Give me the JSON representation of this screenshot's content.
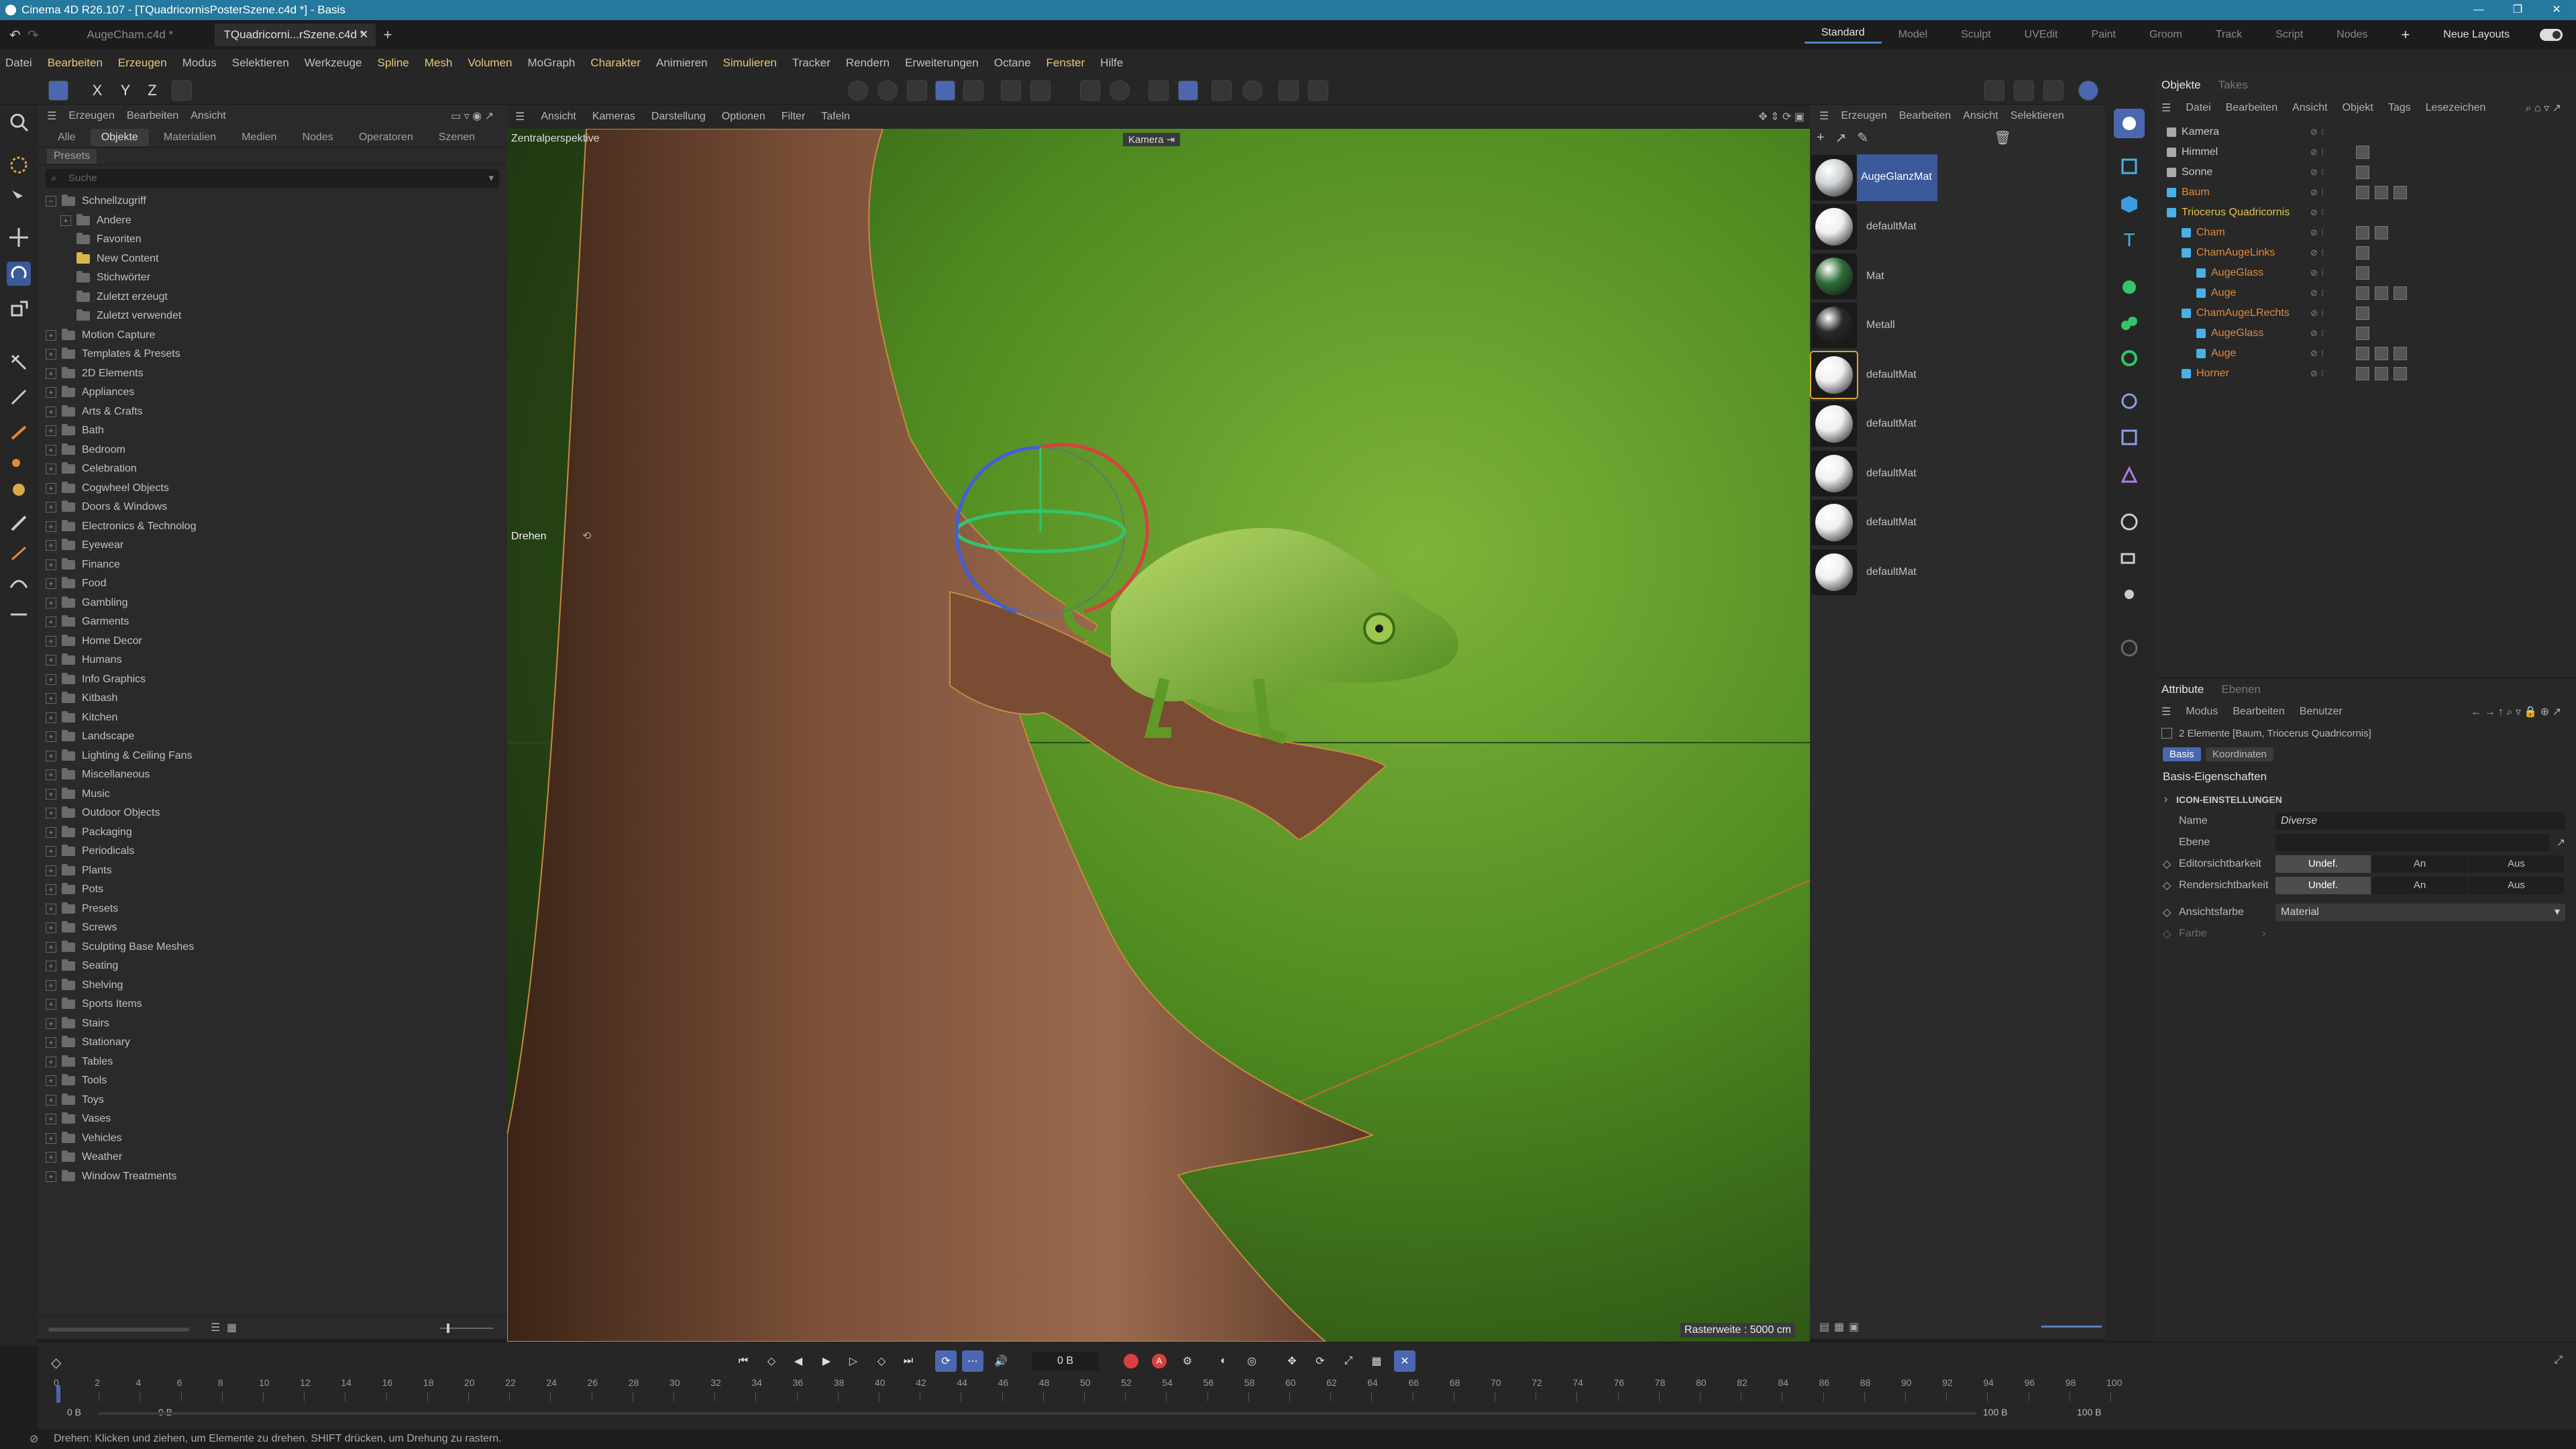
{
  "window": {
    "title": "Cinema 4D R26.107 - [TQuadricornisPosterSzene.c4d *] - Basis"
  },
  "doc_tabs": [
    "AugeCham.c4d *",
    "TQuadricorni...rSzene.c4d *"
  ],
  "layouts": [
    "Standard",
    "Model",
    "Sculpt",
    "UVEdit",
    "Paint",
    "Groom",
    "Track",
    "Script",
    "Nodes"
  ],
  "new_layouts": "Neue Layouts",
  "menu": [
    "Datei",
    "Bearbeiten",
    "Erzeugen",
    "Modus",
    "Selektieren",
    "Werkzeuge",
    "Spline",
    "Mesh",
    "Volumen",
    "MoGraph",
    "Charakter",
    "Animieren",
    "Simulieren",
    "Tracker",
    "Rendern",
    "Erweiterungen",
    "Octane",
    "Fenster",
    "Hilfe"
  ],
  "axis_buttons": [
    "X",
    "Y",
    "Z"
  ],
  "asset": {
    "menu": [
      "Erzeugen",
      "Bearbeiten",
      "Ansicht"
    ],
    "tabs": [
      "Alle",
      "Objekte",
      "Materialien",
      "Medien",
      "Nodes",
      "Operatoren",
      "Szenen"
    ],
    "presets_label": "Presets",
    "search_placeholder": "Suche",
    "quick": [
      "Schnellzugriff",
      "Andere",
      "Favoriten",
      "New Content",
      "Stichwörter",
      "Zuletzt erzeugt",
      "Zuletzt verwendet"
    ],
    "categories": [
      "Motion Capture",
      "Templates & Presets",
      "2D Elements",
      "Appliances",
      "Arts & Crafts",
      "Bath",
      "Bedroom",
      "Celebration",
      "Cogwheel Objects",
      "Doors & Windows",
      "Electronics & Technolog",
      "Eyewear",
      "Finance",
      "Food",
      "Gambling",
      "Garments",
      "Home Decor",
      "Humans",
      "Info Graphics",
      "Kitbash",
      "Kitchen",
      "Landscape",
      "Lighting & Ceiling Fans",
      "Miscellaneous",
      "Music",
      "Outdoor Objects",
      "Packaging",
      "Periodicals",
      "Plants",
      "Pots",
      "Presets",
      "Screws",
      "Sculpting Base Meshes",
      "Seating",
      "Shelving",
      "Sports Items",
      "Stairs",
      "Stationary",
      "Tables",
      "Tools",
      "Toys",
      "Vases",
      "Vehicles",
      "Weather",
      "Window Treatments"
    ]
  },
  "viewport": {
    "menu": [
      "Ansicht",
      "Kameras",
      "Darstellung",
      "Optionen",
      "Filter",
      "Tafeln"
    ],
    "perspective": "Zentralperspektive",
    "camera": "Kamera",
    "tool": "Drehen",
    "grid": "Rasterweite : 5000 cm"
  },
  "materials": {
    "menu": [
      "Erzeugen",
      "Bearbeiten",
      "Ansicht",
      "Selektieren"
    ],
    "items": [
      "AugeGlanzMat",
      "defaultMat",
      "Mat",
      "Metall",
      "defaultMat",
      "defaultMat",
      "defaultMat",
      "defaultMat",
      "defaultMat"
    ]
  },
  "objects": {
    "tabs": [
      "Objekte",
      "Takes"
    ],
    "menu": [
      "Datei",
      "Bearbeiten",
      "Ansicht",
      "Objekt",
      "Tags",
      "Lesezeichen"
    ],
    "items": [
      "Kamera",
      "Himmel",
      "Sonne",
      "Baum",
      "Triocerus Quadricornis",
      "Cham",
      "ChamAugeLinks",
      "AugeGlass",
      "Auge",
      "ChamAugeLRechts",
      "AugeGlass",
      "Auge",
      "Horner"
    ]
  },
  "attributes": {
    "tabs": [
      "Attribute",
      "Ebenen"
    ],
    "menu": [
      "Modus",
      "Bearbeiten",
      "Benutzer"
    ],
    "selection": "2 Elemente [Baum, Triocerus Quadricornis]",
    "subtabs": [
      "Basis",
      "Koordinaten"
    ],
    "section": "Basis-Eigenschaften",
    "group": "ICON-EINSTELLUNGEN",
    "name_label": "Name",
    "name_value": "Diverse",
    "layer_label": "Ebene",
    "editor_label": "Editorsichtbarkeit",
    "render_label": "Rendersichtbarkeit",
    "vis_options": [
      "Undef.",
      "An",
      "Aus"
    ],
    "color_label": "Ansichtsfarbe",
    "color_value": "Material",
    "farbe_label": "Farbe"
  },
  "timeline": {
    "frame": "0 B",
    "start": "0 B",
    "start2": "0 B",
    "end": "100 B",
    "end2": "100 B",
    "ticks": [
      "0",
      "2",
      "4",
      "6",
      "8",
      "10",
      "12",
      "14",
      "16",
      "18",
      "20",
      "22",
      "24",
      "26",
      "28",
      "30",
      "32",
      "34",
      "36",
      "38",
      "40",
      "42",
      "44",
      "46",
      "48",
      "50",
      "52",
      "54",
      "56",
      "58",
      "60",
      "62",
      "64",
      "66",
      "68",
      "70",
      "72",
      "74",
      "76",
      "78",
      "80",
      "82",
      "84",
      "86",
      "88",
      "90",
      "92",
      "94",
      "96",
      "98",
      "100"
    ]
  },
  "status": "Drehen: Klicken und ziehen, um Elemente zu drehen. SHIFT drücken, um Drehung zu rastern."
}
